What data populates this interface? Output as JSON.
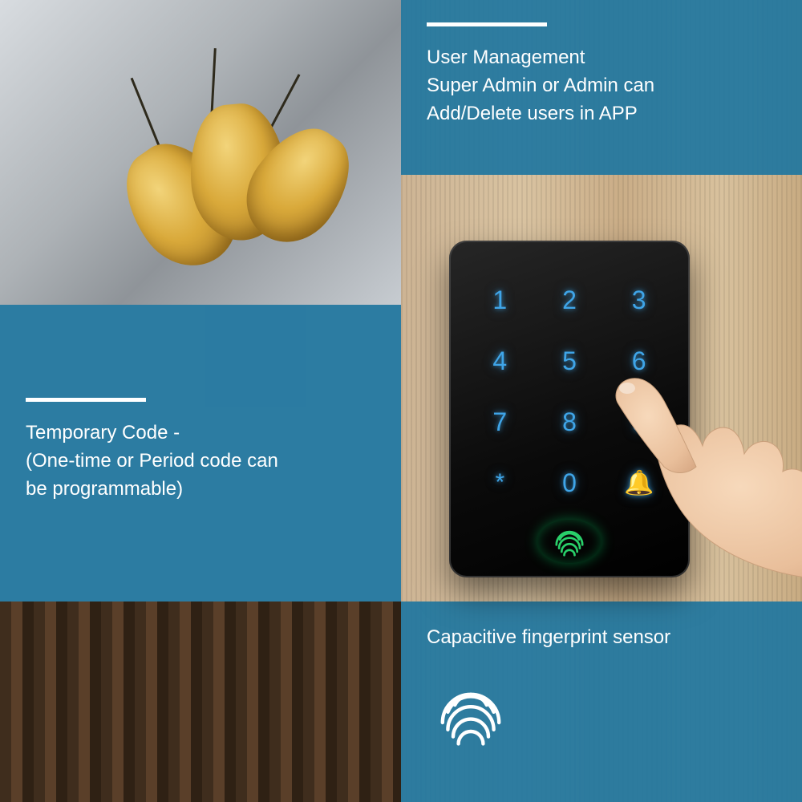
{
  "callouts": {
    "user_management": {
      "line1": "User Management",
      "line2": "Super Admin or Admin can",
      "line3": "Add/Delete users in APP"
    },
    "temporary_code": {
      "line1": "Temporary Code -",
      "line2": "(One-time or Period code can",
      "line3": "be programmable)"
    },
    "fingerprint": {
      "title": "Capacitive fingerprint sensor"
    }
  },
  "keypad": {
    "keys": [
      "1",
      "2",
      "3",
      "4",
      "5",
      "6",
      "7",
      "8",
      "9",
      "*",
      "0",
      "🔔"
    ]
  },
  "colors": {
    "overlay": "#1f76a0",
    "key_glow": "#3fa5e8",
    "fp_glow": "#29d06a"
  }
}
